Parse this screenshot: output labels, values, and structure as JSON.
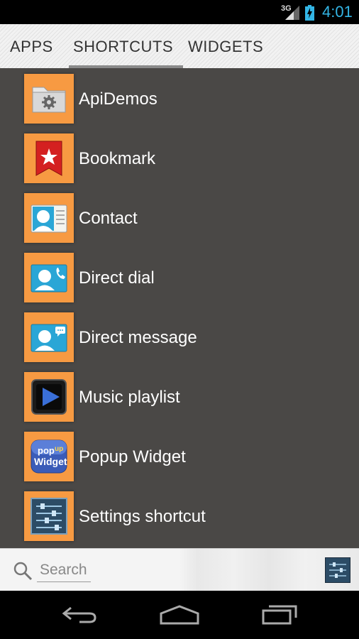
{
  "status_bar": {
    "network": "3G",
    "time": "4:01",
    "icons": [
      "signal-icon",
      "battery-charging-icon"
    ]
  },
  "tabs": [
    {
      "label": "APPS",
      "active": false
    },
    {
      "label": "SHORTCUTS",
      "active": true
    },
    {
      "label": "WIDGETS",
      "active": false
    }
  ],
  "shortcuts": [
    {
      "label": "ApiDemos",
      "icon": "apidemos-folder-icon"
    },
    {
      "label": "Bookmark",
      "icon": "bookmark-icon"
    },
    {
      "label": "Contact",
      "icon": "contact-card-icon"
    },
    {
      "label": "Direct dial",
      "icon": "direct-dial-icon"
    },
    {
      "label": "Direct message",
      "icon": "direct-message-icon"
    },
    {
      "label": "Music playlist",
      "icon": "music-playlist-icon"
    },
    {
      "label": "Popup Widget",
      "icon": "popup-widget-icon"
    },
    {
      "label": "Settings shortcut",
      "icon": "settings-shortcut-icon"
    }
  ],
  "popup_icon_text": [
    "pop",
    "up",
    "Widget"
  ],
  "search": {
    "placeholder": "Search"
  },
  "nav": {
    "icons": [
      "back-icon",
      "home-icon",
      "recent-apps-icon"
    ]
  },
  "colors": {
    "tile_orange": "#f79a42",
    "content_bg": "#4a4846",
    "clock_blue": "#33b5e5"
  }
}
